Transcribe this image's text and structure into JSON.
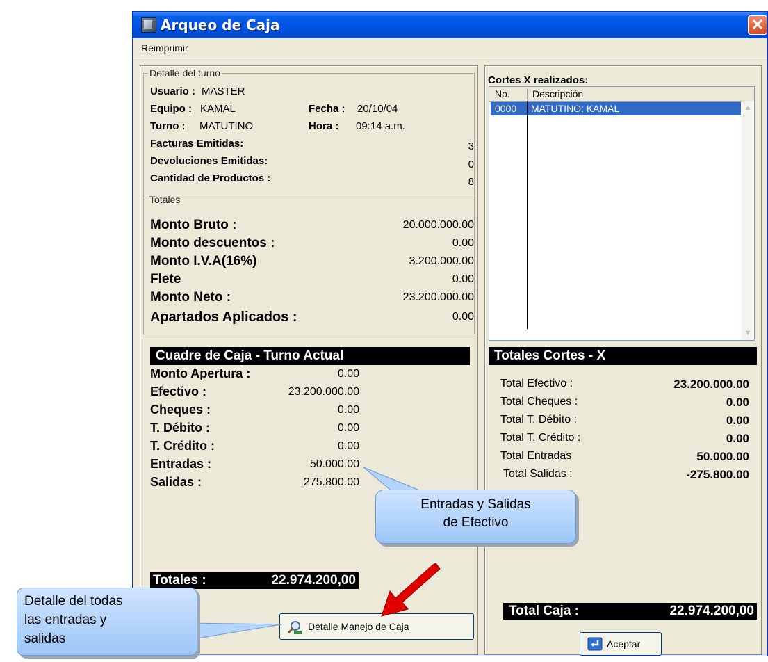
{
  "window": {
    "title": "Arqueo de Caja",
    "close_glyph": "✕"
  },
  "menu": {
    "reimprimir": "Reimprimir"
  },
  "detalle": {
    "group_label": "Detalle del turno",
    "usuario_label": "Usuario :",
    "usuario_value": "MASTER",
    "equipo_label": "Equipo :",
    "equipo_value": "KAMAL",
    "fecha_label": "Fecha :",
    "fecha_value": "20/10/04",
    "turno_label": "Turno :",
    "turno_value": "MATUTINO",
    "hora_label": "Hora :",
    "hora_value": "09:14 a.m.",
    "facturas_label": "Facturas Emitidas:",
    "facturas_value": "3",
    "devoluciones_label": "Devoluciones Emitidas:",
    "devoluciones_value": "0",
    "cantidad_label": "Cantidad de Productos :",
    "cantidad_value": "8"
  },
  "totales": {
    "group_label": "Totales",
    "rows": [
      {
        "label": "Monto Bruto :",
        "value": "20.000.000.00"
      },
      {
        "label": "Monto descuentos :",
        "value": "0.00"
      },
      {
        "label": "Monto I.V.A(16%)",
        "value": "3.200.000.00"
      },
      {
        "label": "Flete",
        "value": "0.00"
      },
      {
        "label": "Monto Neto :",
        "value": "23.200.000.00"
      },
      {
        "label": "Apartados  Aplicados :",
        "value": "0.00"
      }
    ]
  },
  "cuadre": {
    "header": "Cuadre de Caja - Turno Actual",
    "rows": [
      {
        "label": "Monto Apertura :",
        "value": "0.00"
      },
      {
        "label": "Efectivo :",
        "value": "23.200.000.00"
      },
      {
        "label": "Cheques :",
        "value": "0.00"
      },
      {
        "label": "T. Débito :",
        "value": "0.00"
      },
      {
        "label": "T. Crédito :",
        "value": "0.00"
      },
      {
        "label": "Entradas :",
        "value": "50.000.00"
      },
      {
        "label": "Salidas :",
        "value": "275.800.00"
      }
    ],
    "totales_label": "Totales :",
    "totales_value": "22.974.200,00"
  },
  "buttons": {
    "detalle": "Detalle Manejo de Caja",
    "aceptar": "Aceptar"
  },
  "cortes": {
    "title": "Cortes X realizados:",
    "col_no": "No.",
    "col_desc": "Descripción",
    "row": {
      "no": "0000",
      "desc": "MATUTINO: KAMAL"
    }
  },
  "totales_cortes": {
    "header": "Totales Cortes - X",
    "rows": [
      {
        "label": "Total Efectivo :",
        "value": "23.200.000.00"
      },
      {
        "label": "Total Cheques :",
        "value": "0.00"
      },
      {
        "label": "Total T. Débito :",
        "value": "0.00"
      },
      {
        "label": "Total T. Crédito :",
        "value": "0.00"
      },
      {
        "label": "Total Entradas",
        "value": "50.000.00"
      },
      {
        "label": "Total Salidas :",
        "value": "-275.800.00"
      }
    ],
    "total_caja_label": "Total Caja :",
    "total_caja_value": "22.974.200,00"
  },
  "callouts": {
    "entradas_line1": "Entradas y Salidas",
    "entradas_line2": "de Efectivo",
    "detalle_line1": "Detalle  del  todas",
    "detalle_line2": "las    entradas    y",
    "detalle_line3": "salidas"
  },
  "colors": {
    "titlebar": "#0054e3",
    "selection": "#316ac5",
    "callout": "#b4d4fb",
    "arrow": "#e00000"
  },
  "icons": [
    "app-icon",
    "close-icon",
    "search-magnifier-icon",
    "ok-icon",
    "red-arrow"
  ]
}
